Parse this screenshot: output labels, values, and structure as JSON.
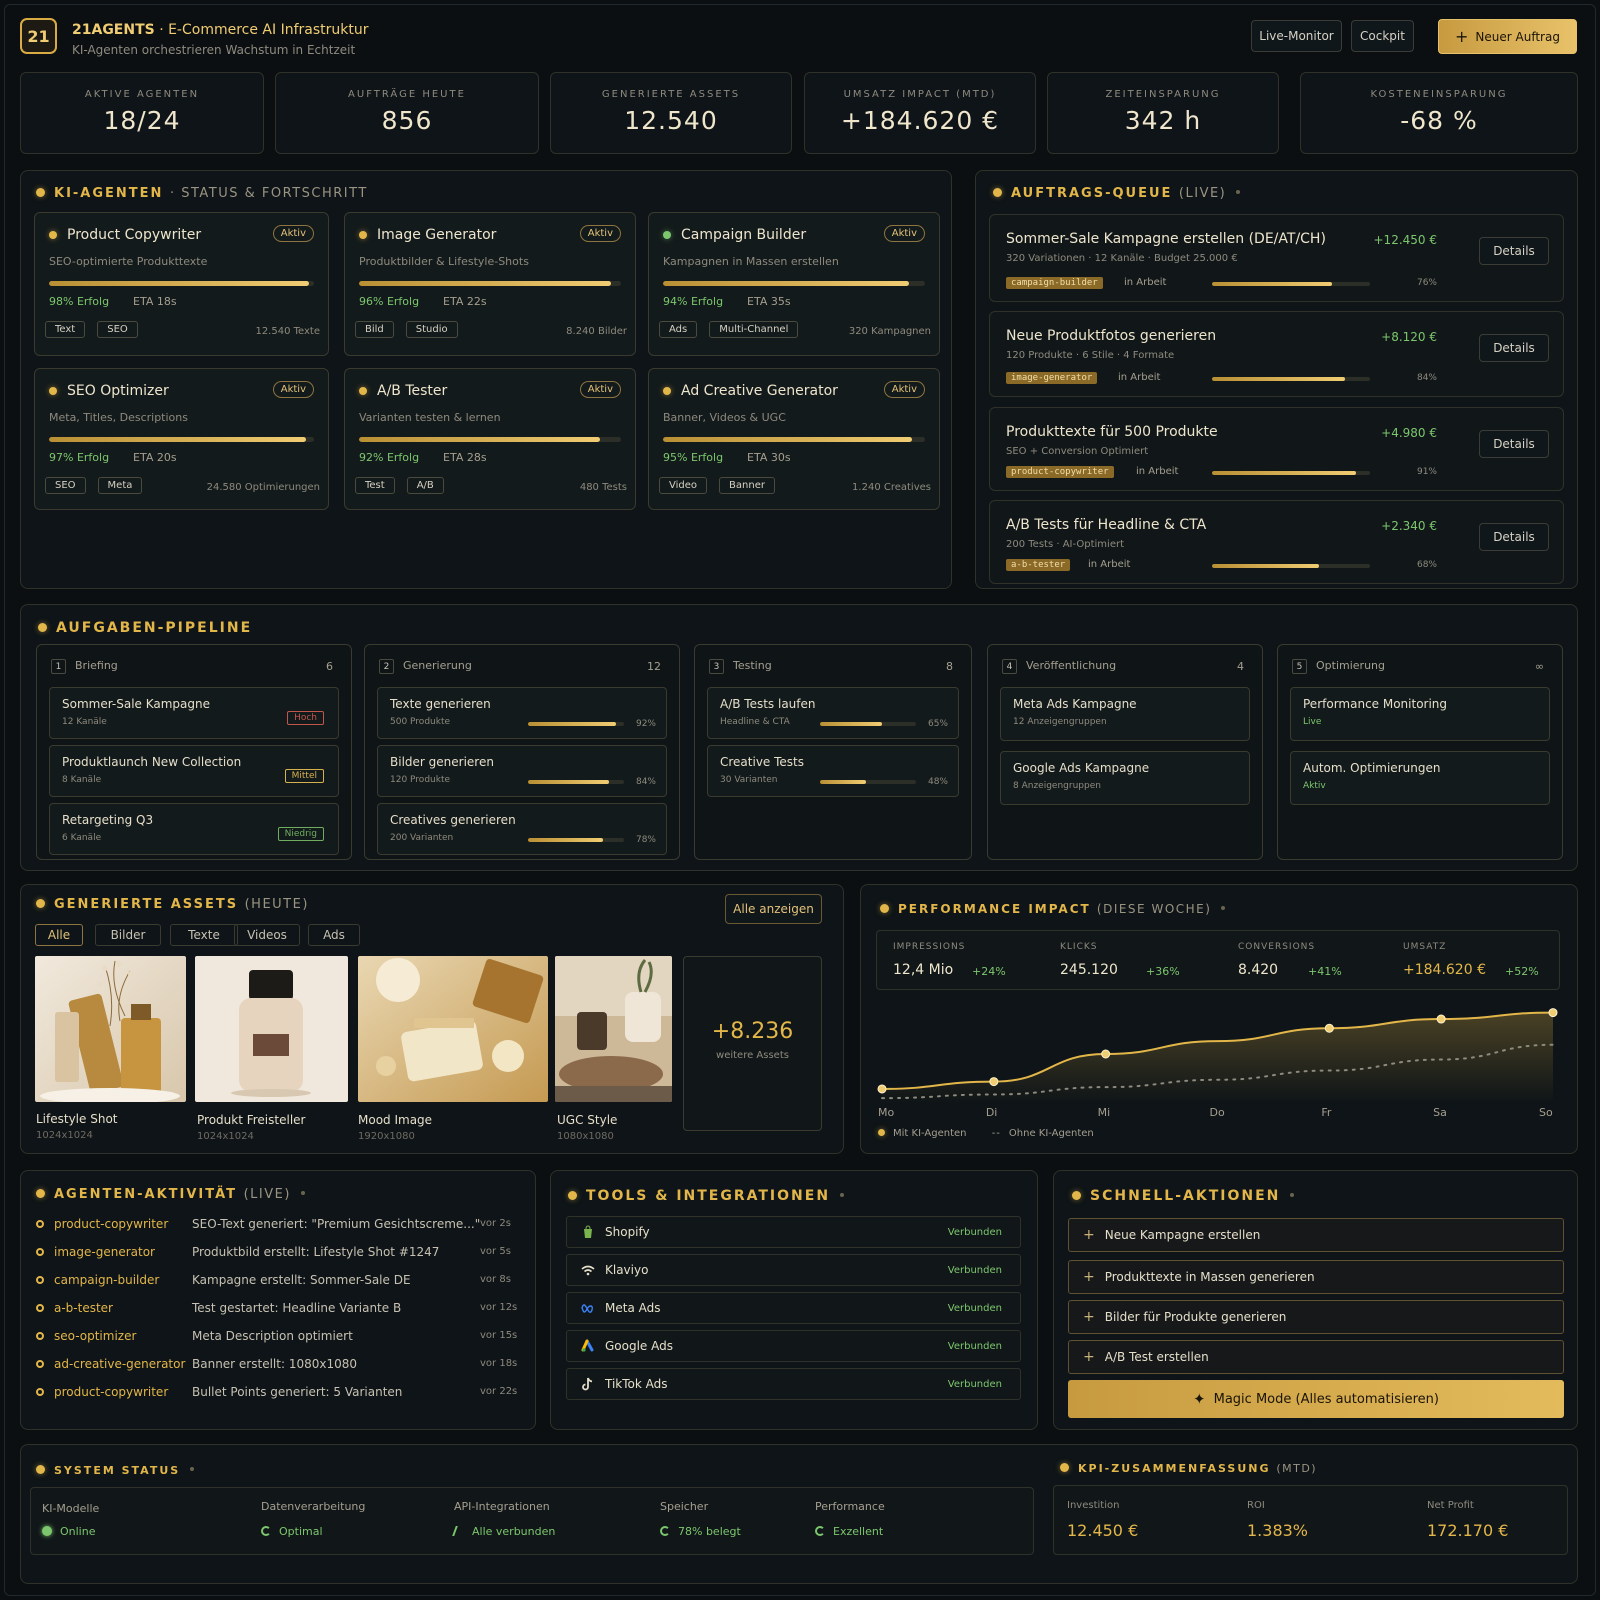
{
  "header": {
    "logo": "21",
    "brand": "21AGENTS",
    "title": "· E-Commerce AI Infrastruktur",
    "subtitle": "KI-Agenten orchestrieren Wachstum in Echtzeit",
    "btn_live": "Live-Monitor",
    "btn_cockpit": "Cockpit",
    "btn_new": "Neuer Auftrag"
  },
  "stats": [
    {
      "label": "AKTIVE AGENTEN",
      "value": "18/24"
    },
    {
      "label": "AUFTRÄGE HEUTE",
      "value": "856"
    },
    {
      "label": "GENERIERTE ASSETS",
      "value": "12.540"
    },
    {
      "label": "UMSATZ IMPACT (MTD)",
      "value": "+184.620 €"
    },
    {
      "label": "ZEITEINSPARUNG",
      "value": "342 h"
    },
    {
      "label": "KOSTENEINSPARUNG",
      "value": "-68 %"
    }
  ],
  "agents_section": {
    "title": "KI-AGENTEN",
    "sub": "· STATUS & FORTSCHRITT"
  },
  "agents": [
    {
      "name": "Product Copywriter",
      "badge": "Aktiv",
      "desc": "SEO-optimierte Produkttexte",
      "progress": 0.98,
      "success": "98% Erfolg",
      "eta": "ETA 18s",
      "tags": [
        "Text",
        "SEO"
      ],
      "count": "12.540 Texte",
      "dot": "#e3b649"
    },
    {
      "name": "Image Generator",
      "badge": "Aktiv",
      "desc": "Produktbilder & Lifestyle-Shots",
      "progress": 0.96,
      "success": "96% Erfolg",
      "eta": "ETA 22s",
      "tags": [
        "Bild",
        "Studio"
      ],
      "count": "8.240 Bilder",
      "dot": "#e3b649"
    },
    {
      "name": "Campaign Builder",
      "badge": "Aktiv",
      "desc": "Kampagnen in Massen erstellen",
      "progress": 0.94,
      "success": "94% Erfolg",
      "eta": "ETA 35s",
      "tags": [
        "Ads",
        "Multi-Channel"
      ],
      "count": "320 Kampagnen",
      "dot": "#7cc76d"
    },
    {
      "name": "SEO Optimizer",
      "badge": "Aktiv",
      "desc": "Meta, Titles, Descriptions",
      "progress": 0.97,
      "success": "97% Erfolg",
      "eta": "ETA 20s",
      "tags": [
        "SEO",
        "Meta"
      ],
      "count": "24.580 Optimierungen",
      "dot": "#e3b649"
    },
    {
      "name": "A/B Tester",
      "badge": "Aktiv",
      "desc": "Varianten testen & lernen",
      "progress": 0.92,
      "success": "92% Erfolg",
      "eta": "ETA 28s",
      "tags": [
        "Test",
        "A/B"
      ],
      "count": "480 Tests",
      "dot": "#e3b649"
    },
    {
      "name": "Ad Creative Generator",
      "badge": "Aktiv",
      "desc": "Banner, Videos & UGC",
      "progress": 0.95,
      "success": "95% Erfolg",
      "eta": "ETA 30s",
      "tags": [
        "Video",
        "Banner"
      ],
      "count": "1.240 Creatives",
      "dot": "#e3b649"
    }
  ],
  "queue_section": {
    "title": "AUFTRAGS-QUEUE",
    "sub": "(LIVE)"
  },
  "queue": [
    {
      "title": "Sommer-Sale Kampagne erstellen (DE/AT/CH)",
      "sub": "320 Variationen · 12 Kanäle · Budget 25.000 €",
      "amount": "+12.450 €",
      "chip": "campaign-builder",
      "state": "in Arbeit",
      "progress": 0.76,
      "pct": "76%",
      "btn": "Details"
    },
    {
      "title": "Neue Produktfotos generieren",
      "sub": "120 Produkte · 6 Stile · 4 Formate",
      "amount": "+8.120 €",
      "chip": "image-generator",
      "state": "in Arbeit",
      "progress": 0.84,
      "pct": "84%",
      "btn": "Details"
    },
    {
      "title": "Produkttexte für 500 Produkte",
      "sub": "SEO + Conversion Optimiert",
      "amount": "+4.980 €",
      "chip": "product-copywriter",
      "state": "in Arbeit",
      "progress": 0.91,
      "pct": "91%",
      "btn": "Details"
    },
    {
      "title": "A/B Tests für Headline & CTA",
      "sub": "200 Tests · AI-Optimiert",
      "amount": "+2.340 €",
      "chip": "a-b-tester",
      "state": "in Arbeit",
      "progress": 0.68,
      "pct": "68%",
      "btn": "Details"
    }
  ],
  "pipeline_section": {
    "title": "AUFGABEN-PIPELINE"
  },
  "pipeline": [
    {
      "num": "1",
      "name": "Briefing",
      "count": "6",
      "cards": [
        {
          "title": "Sommer-Sale Kampagne",
          "sub": "12 Kanäle",
          "priority": "Hoch",
          "pcolor": "#c0574a"
        },
        {
          "title": "Produktlaunch New Collection",
          "sub": "8 Kanäle",
          "priority": "Mittel",
          "pcolor": "#d8b14f"
        },
        {
          "title": "Retargeting Q3",
          "sub": "6 Kanäle",
          "priority": "Niedrig",
          "pcolor": "#6fae5f"
        }
      ]
    },
    {
      "num": "2",
      "name": "Generierung",
      "count": "12",
      "cards": [
        {
          "title": "Texte generieren",
          "sub": "500 Produkte",
          "progress": 0.92,
          "pct": "92%"
        },
        {
          "title": "Bilder generieren",
          "sub": "120 Produkte",
          "progress": 0.84,
          "pct": "84%"
        },
        {
          "title": "Creatives generieren",
          "sub": "200 Varianten",
          "progress": 0.78,
          "pct": "78%"
        }
      ]
    },
    {
      "num": "3",
      "name": "Testing",
      "count": "8",
      "cards": [
        {
          "title": "A/B Tests laufen",
          "sub": "Headline & CTA",
          "progress": 0.65,
          "pct": "65%"
        },
        {
          "title": "Creative Tests",
          "sub": "30 Varianten",
          "progress": 0.48,
          "pct": "48%"
        }
      ]
    },
    {
      "num": "4",
      "name": "Veröffentlichung",
      "count": "4",
      "cards": [
        {
          "title": "Meta Ads Kampagne",
          "sub": "12 Anzeigengruppen"
        },
        {
          "title": "Google Ads Kampagne",
          "sub": "8 Anzeigengruppen"
        }
      ]
    },
    {
      "num": "5",
      "name": "Optimierung",
      "count": "∞",
      "cards": [
        {
          "title": "Performance Monitoring",
          "sub": "Live",
          "subGreen": true
        },
        {
          "title": "Autom. Optimierungen",
          "sub": "Aktiv",
          "subGreen": true
        }
      ]
    }
  ],
  "assets_section": {
    "title": "GENERIERTE ASSETS",
    "sub": "(HEUTE)",
    "btn_all": "Alle anzeigen"
  },
  "asset_filters": [
    "Alle",
    "Bilder",
    "Texte",
    "Videos",
    "Ads"
  ],
  "assets": [
    {
      "name": "Lifestyle Shot",
      "size": "1024x1024"
    },
    {
      "name": "Produkt Freisteller",
      "size": "1024x1024"
    },
    {
      "name": "Mood Image",
      "size": "1920x1080"
    },
    {
      "name": "UGC Style",
      "size": "1080x1080"
    }
  ],
  "assets_more": {
    "value": "+8.236",
    "label": "weitere Assets"
  },
  "performance_section": {
    "title": "PERFORMANCE IMPACT",
    "sub": "(DIESE WOCHE)"
  },
  "performance_metrics": [
    {
      "label": "IMPRESSIONS",
      "value": "12,4 Mio",
      "growth": "+24%"
    },
    {
      "label": "KLICKS",
      "value": "245.120",
      "growth": "+36%"
    },
    {
      "label": "CONVERSIONS",
      "value": "8.420",
      "growth": "+41%"
    },
    {
      "label": "UMSATZ",
      "value": "+184.620 €",
      "growth": "+52%"
    }
  ],
  "chart_data": {
    "type": "line",
    "categories": [
      "Mo",
      "Di",
      "Mi",
      "Do",
      "Fr",
      "Sa",
      "So"
    ],
    "series": [
      {
        "name": "Mit KI-Agenten",
        "values": [
          12,
          20,
          50,
          64,
          78,
          88,
          95
        ],
        "color": "#e3b649"
      },
      {
        "name": "Ohne KI-Agenten",
        "values": [
          2,
          6,
          14,
          22,
          32,
          44,
          60
        ],
        "color": "#8e8a7e"
      }
    ],
    "ylim": [
      0,
      100
    ],
    "grid": false,
    "legend": "bottom-left"
  },
  "activity_section": {
    "title": "AGENTEN-AKTIVITÄT",
    "sub": "(LIVE)"
  },
  "activity": [
    {
      "agent": "product-copywriter",
      "msg": "SEO-Text generiert: \"Premium Gesichtscreme...\"",
      "time": "vor 2s"
    },
    {
      "agent": "image-generator",
      "msg": "Produktbild erstellt: Lifestyle Shot #1247",
      "time": "vor 5s"
    },
    {
      "agent": "campaign-builder",
      "msg": "Kampagne erstellt: Sommer-Sale DE",
      "time": "vor 8s"
    },
    {
      "agent": "a-b-tester",
      "msg": "Test gestartet: Headline Variante B",
      "time": "vor 12s"
    },
    {
      "agent": "seo-optimizer",
      "msg": "Meta Description optimiert",
      "time": "vor 15s"
    },
    {
      "agent": "ad-creative-generator",
      "msg": "Banner erstellt: 1080x1080",
      "time": "vor 18s"
    },
    {
      "agent": "product-copywriter",
      "msg": "Bullet Points generiert: 5 Varianten",
      "time": "vor 22s"
    }
  ],
  "tools_section": {
    "title": "TOOLS & INTEGRATIONEN"
  },
  "tools": [
    {
      "name": "Shopify",
      "status": "Verbunden",
      "icon": "shopify-icon",
      "color": "#7bb34e"
    },
    {
      "name": "Klaviyo",
      "status": "Verbunden",
      "icon": "klaviyo-icon",
      "color": "#e6dfca"
    },
    {
      "name": "Meta Ads",
      "status": "Verbunden",
      "icon": "meta-icon",
      "color": "#3b82f6"
    },
    {
      "name": "Google Ads",
      "status": "Verbunden",
      "icon": "google-ads-icon",
      "color": "#fbbc04"
    },
    {
      "name": "TikTok Ads",
      "status": "Verbunden",
      "icon": "tiktok-icon",
      "color": "#e6dfca"
    }
  ],
  "quick_section": {
    "title": "SCHNELL-AKTIONEN"
  },
  "quick_actions": [
    "Neue Kampagne erstellen",
    "Produkttexte in Massen generieren",
    "Bilder für Produkte generieren",
    "A/B Test erstellen"
  ],
  "magic_button": "Magic Mode (Alles automatisieren)",
  "system_section": {
    "title": "SYSTEM STATUS"
  },
  "system": [
    {
      "label": "KI-Modelle",
      "value": "Online"
    },
    {
      "label": "Datenverarbeitung",
      "value": "Optimal"
    },
    {
      "label": "API-Integrationen",
      "value": "Alle verbunden"
    },
    {
      "label": "Speicher",
      "value": "78% belegt"
    },
    {
      "label": "Performance",
      "value": "Exzellent"
    }
  ],
  "kpi_section": {
    "title": "KPI-ZUSAMMENFASSUNG",
    "sub": "(MTD)"
  },
  "kpis": [
    {
      "label": "Investition",
      "value": "12.450 €"
    },
    {
      "label": "ROI",
      "value": "1.383%"
    },
    {
      "label": "Net Profit",
      "value": "172.170 €"
    }
  ]
}
